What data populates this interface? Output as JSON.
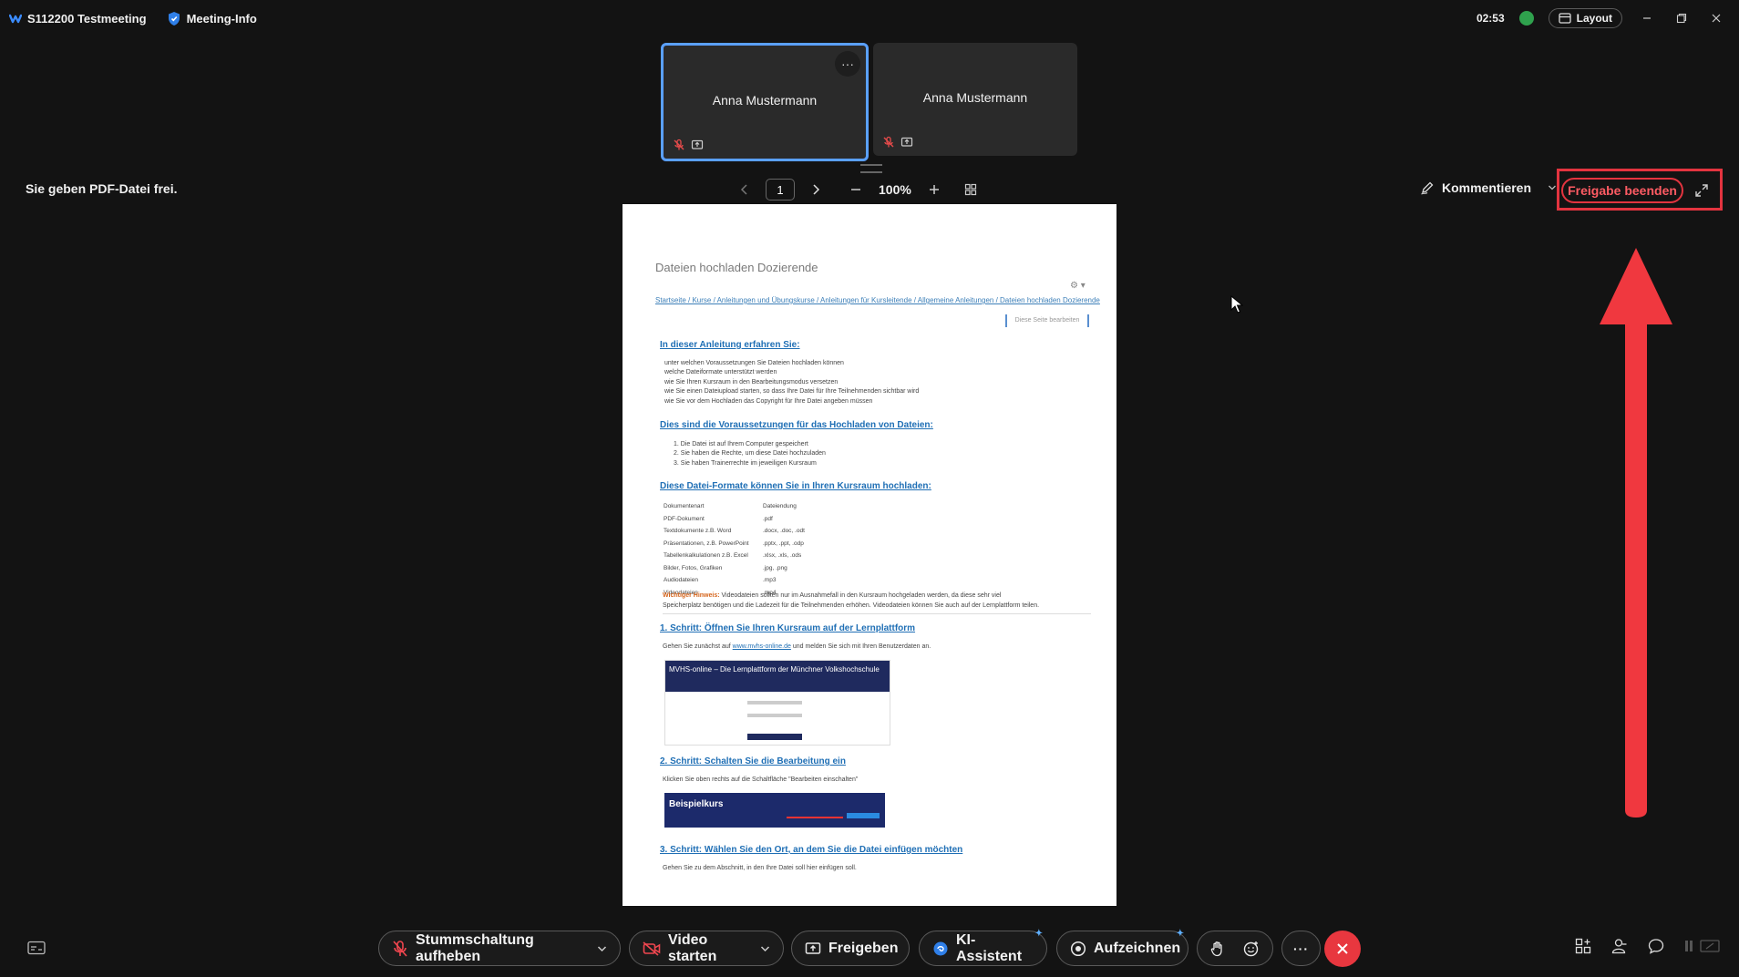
{
  "title_bar": {
    "meeting_title": "S112200 Testmeeting",
    "meeting_info": "Meeting-Info",
    "time": "02:53",
    "layout_label": "Layout"
  },
  "participants": [
    {
      "name": "Anna Mustermann"
    },
    {
      "name": "Anna Mustermann"
    }
  ],
  "share_bar": {
    "status_text": "Sie geben PDF-Datei frei.",
    "page_number": "1",
    "zoom": "100%",
    "annotate_label": "Kommentieren",
    "stop_share_label": "Freigabe beenden"
  },
  "document": {
    "title": "Dateien hochladen Dozierende",
    "breadcrumb": "Startseite / Kurse / Anleitungen und Übungskurse / Anleitungen für Kursleitende / Allgemeine Anleitungen / Dateien hochladen Dozierende",
    "edit_button": "Diese Seite bearbeiten",
    "heading_1": "In dieser Anleitung erfahren Sie:",
    "list_1": [
      "unter welchen Voraussetzungen Sie Dateien hochladen können",
      "welche Dateiformate unterstützt werden",
      "wie Sie Ihren Kursraum in den Bearbeitungsmodus versetzen",
      "wie Sie einen Dateiupload starten, so dass Ihre Datei für Ihre Teilnehmenden sichtbar wird",
      "wie Sie vor dem Hochladen das Copyright für Ihre Datei angeben müssen"
    ],
    "heading_2": "Dies sind die Voraussetzungen für das Hochladen von Dateien:",
    "list_2": [
      "1. Die Datei ist auf Ihrem Computer gespeichert",
      "2. Sie haben die Rechte, um diese Datei hochzuladen",
      "3. Sie haben Trainerrechte im jeweiligen Kursraum"
    ],
    "heading_3": "Diese Datei-Formate können Sie in Ihren Kursraum hochladen:",
    "format_table": [
      [
        "Dokumentenart",
        "Dateiendung"
      ],
      [
        "PDF-Dokument",
        ".pdf"
      ],
      [
        "Textdokumente z.B. Word",
        ".docx, .doc, .odt"
      ],
      [
        "Präsentationen, z.B. PowerPoint",
        ".pptx, .ppt, .odp"
      ],
      [
        "Tabellenkalkulationen z.B. Excel",
        ".xlsx, .xls, .ods"
      ],
      [
        "Bilder, Fotos, Grafiken",
        ".jpg, .png"
      ],
      [
        "Audiodateien",
        ".mp3"
      ],
      [
        "Videodateien",
        ".mp4"
      ]
    ],
    "warning_label": "Wichtiger Hinweis:",
    "warning_line_1": " Videodateien sollten nur im Ausnahmefall in den Kursraum hochgeladen werden, da diese sehr viel",
    "warning_line_2": "Speicherplatz benötigen und die Ladezeit für die Teilnehmenden erhöhen. Videodateien können Sie auch auf der Lernplattform teilen.",
    "step_1": "1. Schritt: Öffnen Sie Ihren Kursraum auf der Lernplattform",
    "step_1_text_a": "Gehen Sie zunächst auf ",
    "step_1_link": "www.mvhs-online.de",
    "step_1_text_b": " und melden Sie sich mit Ihren Benutzerdaten an.",
    "img1_text": "MVHS-online – Die Lernplattform der Münchner Volkshochschule",
    "step_2": "2. Schritt: Schalten Sie die Bearbeitung ein",
    "step_2_text": "Klicken Sie oben rechts auf die Schaltfläche \"Bearbeiten einschalten\"",
    "img2_text": "Beispielkurs",
    "step_3": "3. Schritt: Wählen Sie den Ort, an dem Sie die Datei einfügen möchten",
    "step_3_text": "Gehen Sie zu dem Abschnitt, in den Ihre Datei soll hier einfügen soll."
  },
  "toolbar": {
    "unmute_label": "Stummschaltung aufheben",
    "video_label": "Video starten",
    "share_label": "Freigeben",
    "ai_label": "KI-Assistent",
    "record_label": "Aufzeichnen"
  },
  "colors": {
    "background": "#131313",
    "highlight_red": "#e3343f",
    "end_call": "#e8373f",
    "active_tile_border": "#5aa0ff"
  },
  "icons": [
    "webex-logo-icon",
    "shield-icon",
    "green-status-icon",
    "layout-icon",
    "minimize-icon",
    "restore-icon",
    "close-icon",
    "mic-muted-icon",
    "screen-share-icon",
    "more-icon",
    "prev-page-icon",
    "next-page-icon",
    "zoom-out-icon",
    "zoom-in-icon",
    "thumbnails-icon",
    "pen-icon",
    "fullscreen-icon",
    "captions-icon",
    "video-off-icon",
    "share-icon",
    "ai-assistant-icon",
    "record-icon",
    "raise-hand-icon",
    "reaction-icon",
    "end-call-icon",
    "apps-icon",
    "participants-icon",
    "chat-icon",
    "view-icon",
    "mouse-cursor-icon",
    "arrow-annotation"
  ]
}
